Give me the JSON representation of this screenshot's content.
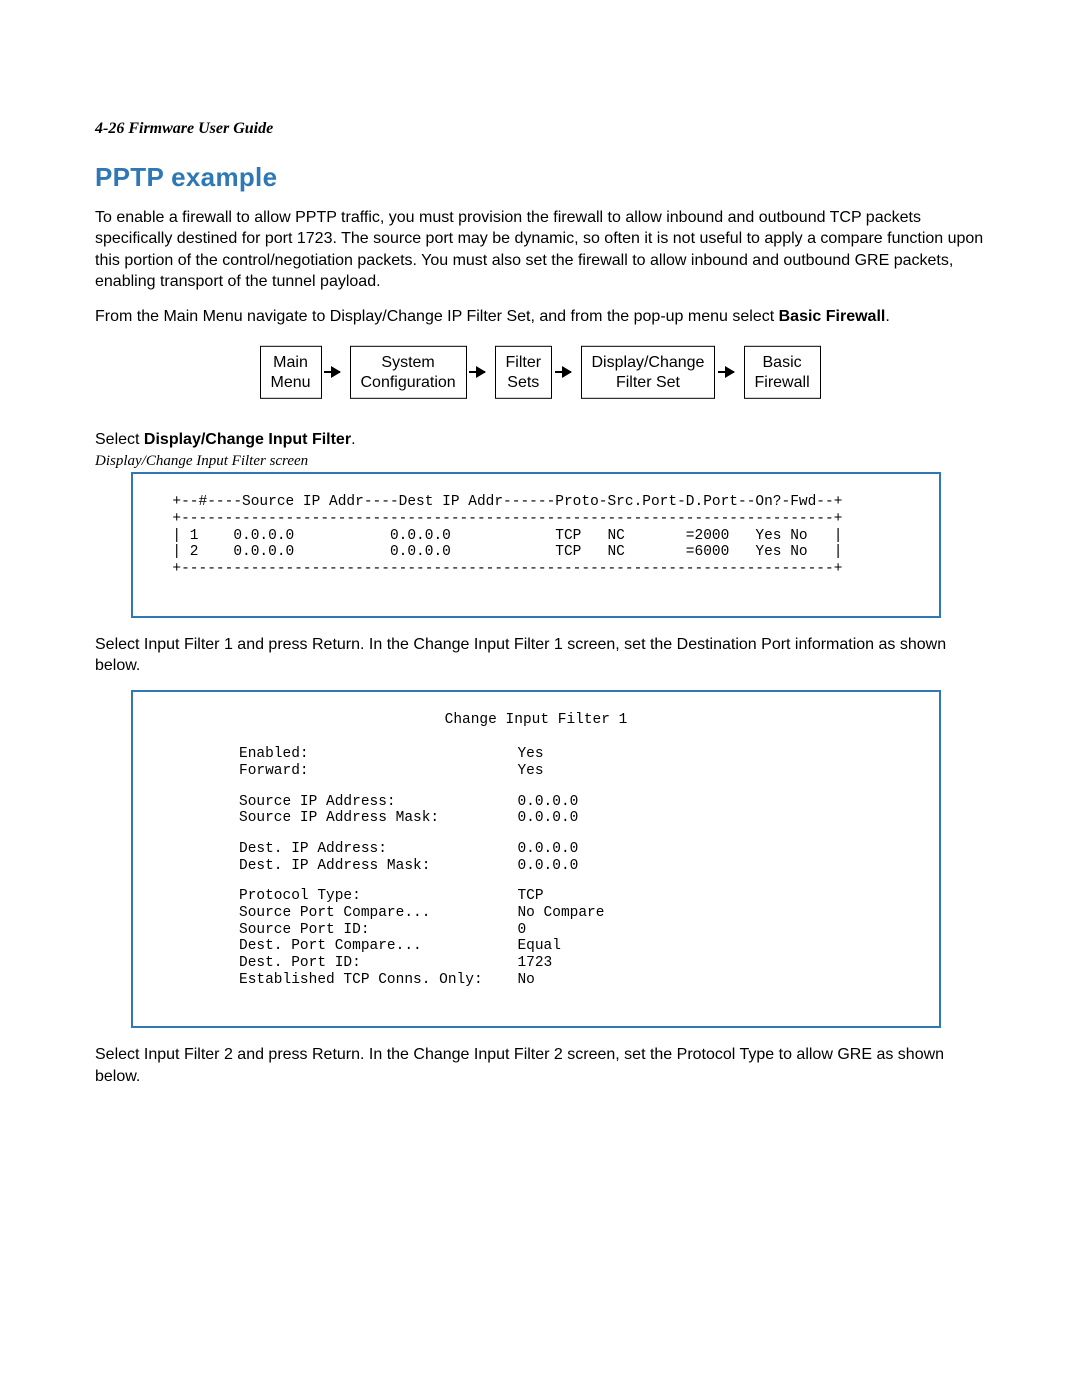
{
  "header": "4-26  Firmware User Guide",
  "title": "PPTP example",
  "para1": "To enable a firewall to allow PPTP traffic, you must provision the firewall to allow inbound and outbound TCP packets specifically destined for port 1723. The source port may be dynamic, so often it is not useful to apply a compare function upon this portion of the control/negotiation packets. You must also set the firewall to allow inbound and outbound GRE packets, enabling transport of the tunnel payload.",
  "para2_a": "From the Main Menu navigate to Display/Change IP Filter Set, and from the pop-up menu select ",
  "para2_b": "Basic Firewall",
  "para2_c": ".",
  "breadcrumbs": {
    "c0": "Main\nMenu",
    "c1": "System\nConfiguration",
    "c2": "Filter\nSets",
    "c3": "Display/Change\nFilter Set",
    "c4": "Basic\nFirewall"
  },
  "instr1_a": "Select ",
  "instr1_b": "Display/Change Input Filter",
  "instr1_c": ".",
  "caption1": "Display/Change Input Filter screen",
  "filter_table": {
    "header": "+--#----Source IP Addr----Dest IP Addr------Proto-Src.Port-D.Port--On?-Fwd--+",
    "sep": "+---------------------------------------------------------------------------+",
    "rows": [
      "| 1    0.0.0.0           0.0.0.0            TCP   NC       =2000   Yes No   |",
      "| 2    0.0.0.0           0.0.0.0            TCP   NC       =6000   Yes No   |"
    ]
  },
  "para3": "Select Input Filter 1 and press Return. In the Change Input Filter 1 screen, set the Destination Port information as shown below.",
  "form": {
    "title": "Change Input Filter 1",
    "g1": [
      {
        "label": "Enabled:",
        "value": "Yes"
      },
      {
        "label": "Forward:",
        "value": "Yes"
      }
    ],
    "g2": [
      {
        "label": "Source IP Address:",
        "value": "0.0.0.0"
      },
      {
        "label": "Source IP Address Mask:",
        "value": "0.0.0.0"
      }
    ],
    "g3": [
      {
        "label": "Dest. IP Address:",
        "value": "0.0.0.0"
      },
      {
        "label": "Dest. IP Address Mask:",
        "value": "0.0.0.0"
      }
    ],
    "g4": [
      {
        "label": "Protocol Type:",
        "value": "TCP"
      },
      {
        "label": "Source Port Compare...",
        "value": "No Compare"
      },
      {
        "label": "Source Port ID:",
        "value": "0"
      },
      {
        "label": "Dest. Port Compare...",
        "value": "Equal"
      },
      {
        "label": "Dest. Port ID:",
        "value": "1723"
      },
      {
        "label": "Established TCP Conns. Only:",
        "value": "No"
      }
    ]
  },
  "para4": "Select Input Filter 2 and press Return. In the Change Input Filter 2 screen, set the Protocol Type to allow GRE as shown below."
}
